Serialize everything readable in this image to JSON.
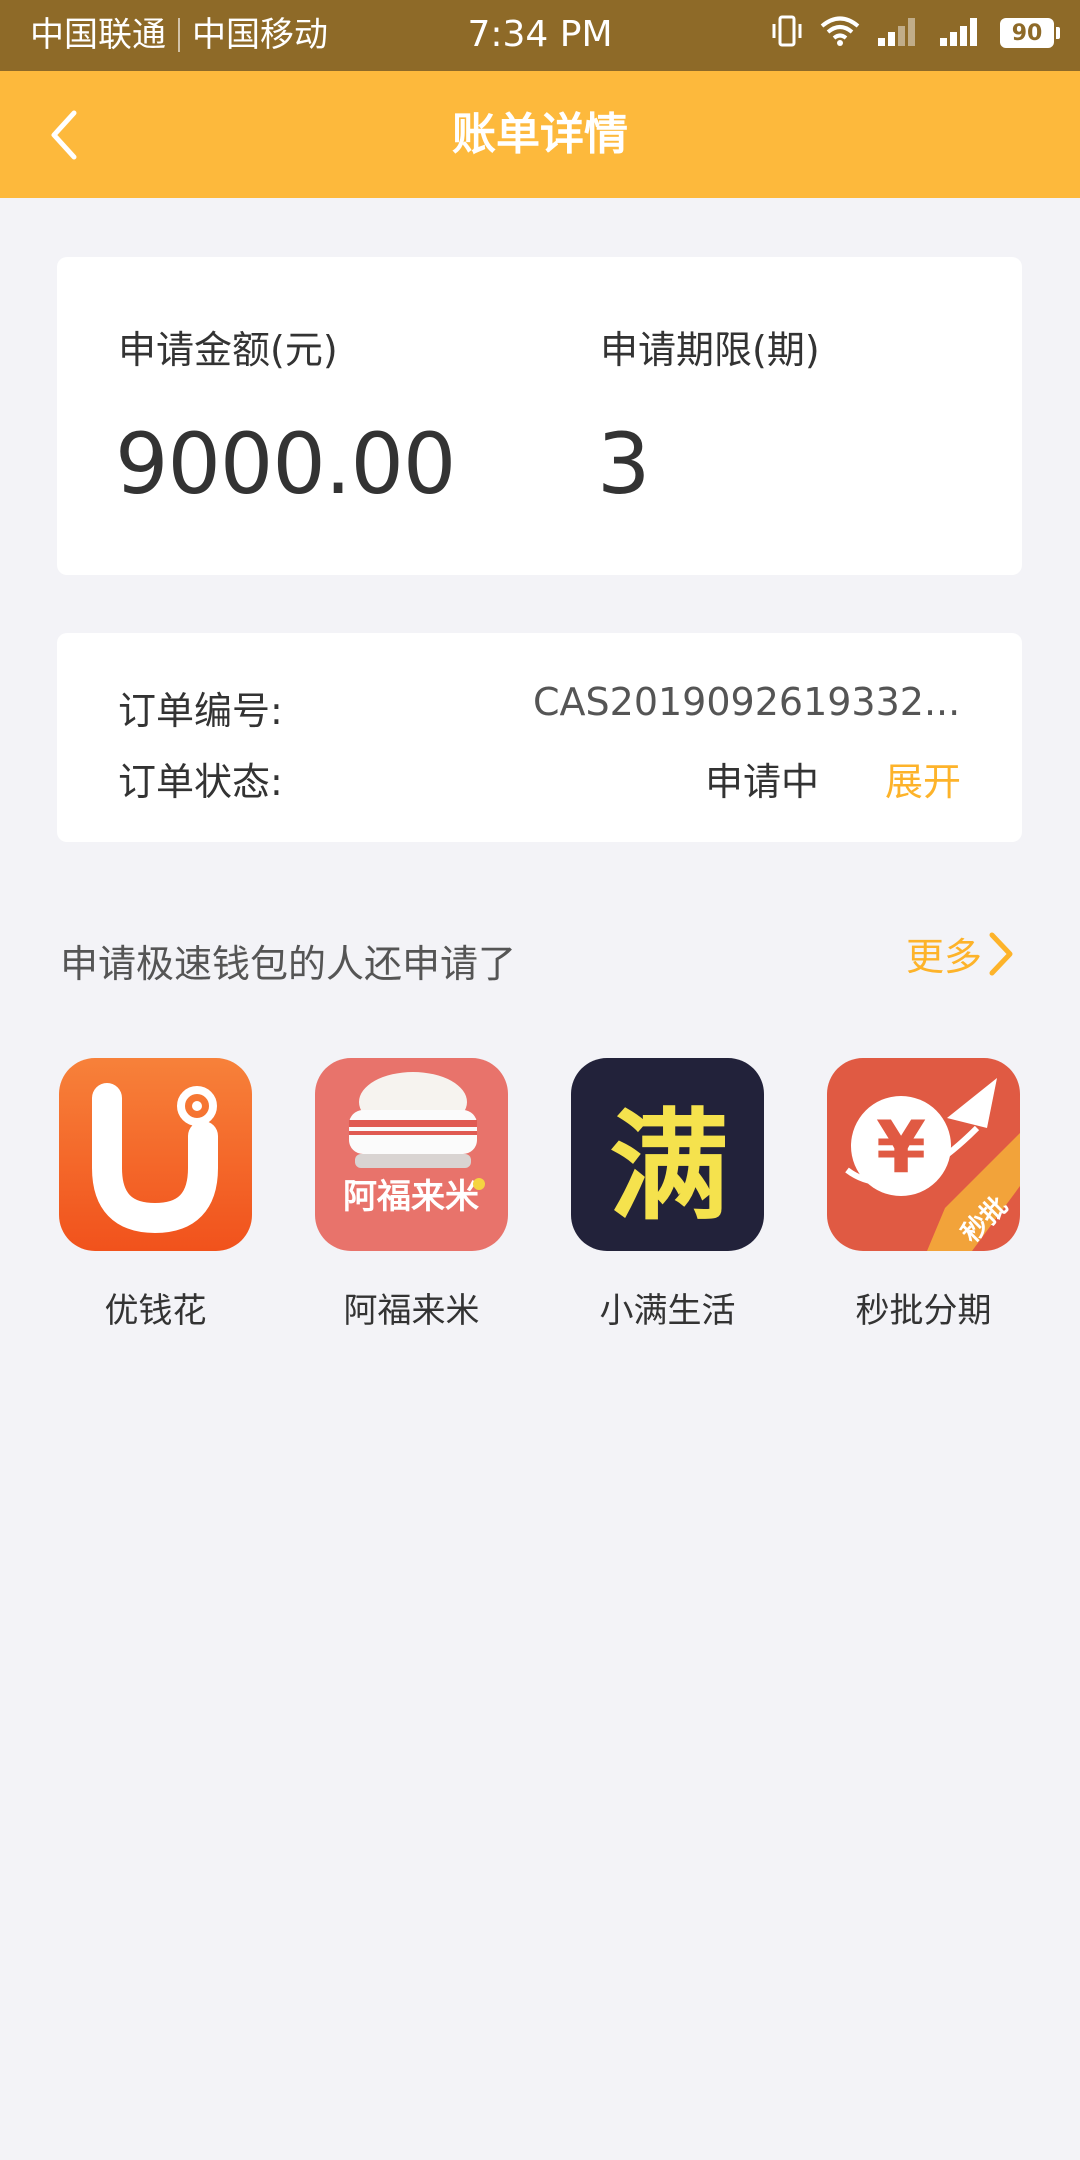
{
  "status_bar": {
    "carrier1": "中国联通",
    "carrier2": "中国移动",
    "time": "7:34 PM",
    "battery": "90",
    "icons": [
      "vibrate-icon",
      "wifi-icon",
      "signal-weak-icon",
      "signal-icon",
      "battery-icon"
    ]
  },
  "nav": {
    "title": "账单详情",
    "back_icon": "chevron-left-icon"
  },
  "summary": {
    "amount_label": "申请金额(元)",
    "amount_value": "9000.00",
    "term_label": "申请期限(期)",
    "term_value": "3"
  },
  "order": {
    "id_label": "订单编号:",
    "id_value": "CAS2019092619332...",
    "status_label": "订单状态:",
    "status_value": "申请中",
    "expand_label": "展开"
  },
  "recommend": {
    "title": "申请极速钱包的人还申请了",
    "more_label": "更多",
    "apps": [
      {
        "name": "优钱花",
        "icon": "youqianhua-icon"
      },
      {
        "name": "阿福来米",
        "icon": "afulaimi-icon",
        "icon_text": "阿福来米"
      },
      {
        "name": "小满生活",
        "icon": "xiaoman-icon",
        "icon_text": "满"
      },
      {
        "name": "秒批分期",
        "icon": "miaopi-icon",
        "icon_text": "秒批"
      }
    ]
  },
  "colors": {
    "status_bar": "#8e6a28",
    "nav_bar": "#fdb93c",
    "accent": "#fdb32a",
    "background": "#f3f3f7"
  }
}
